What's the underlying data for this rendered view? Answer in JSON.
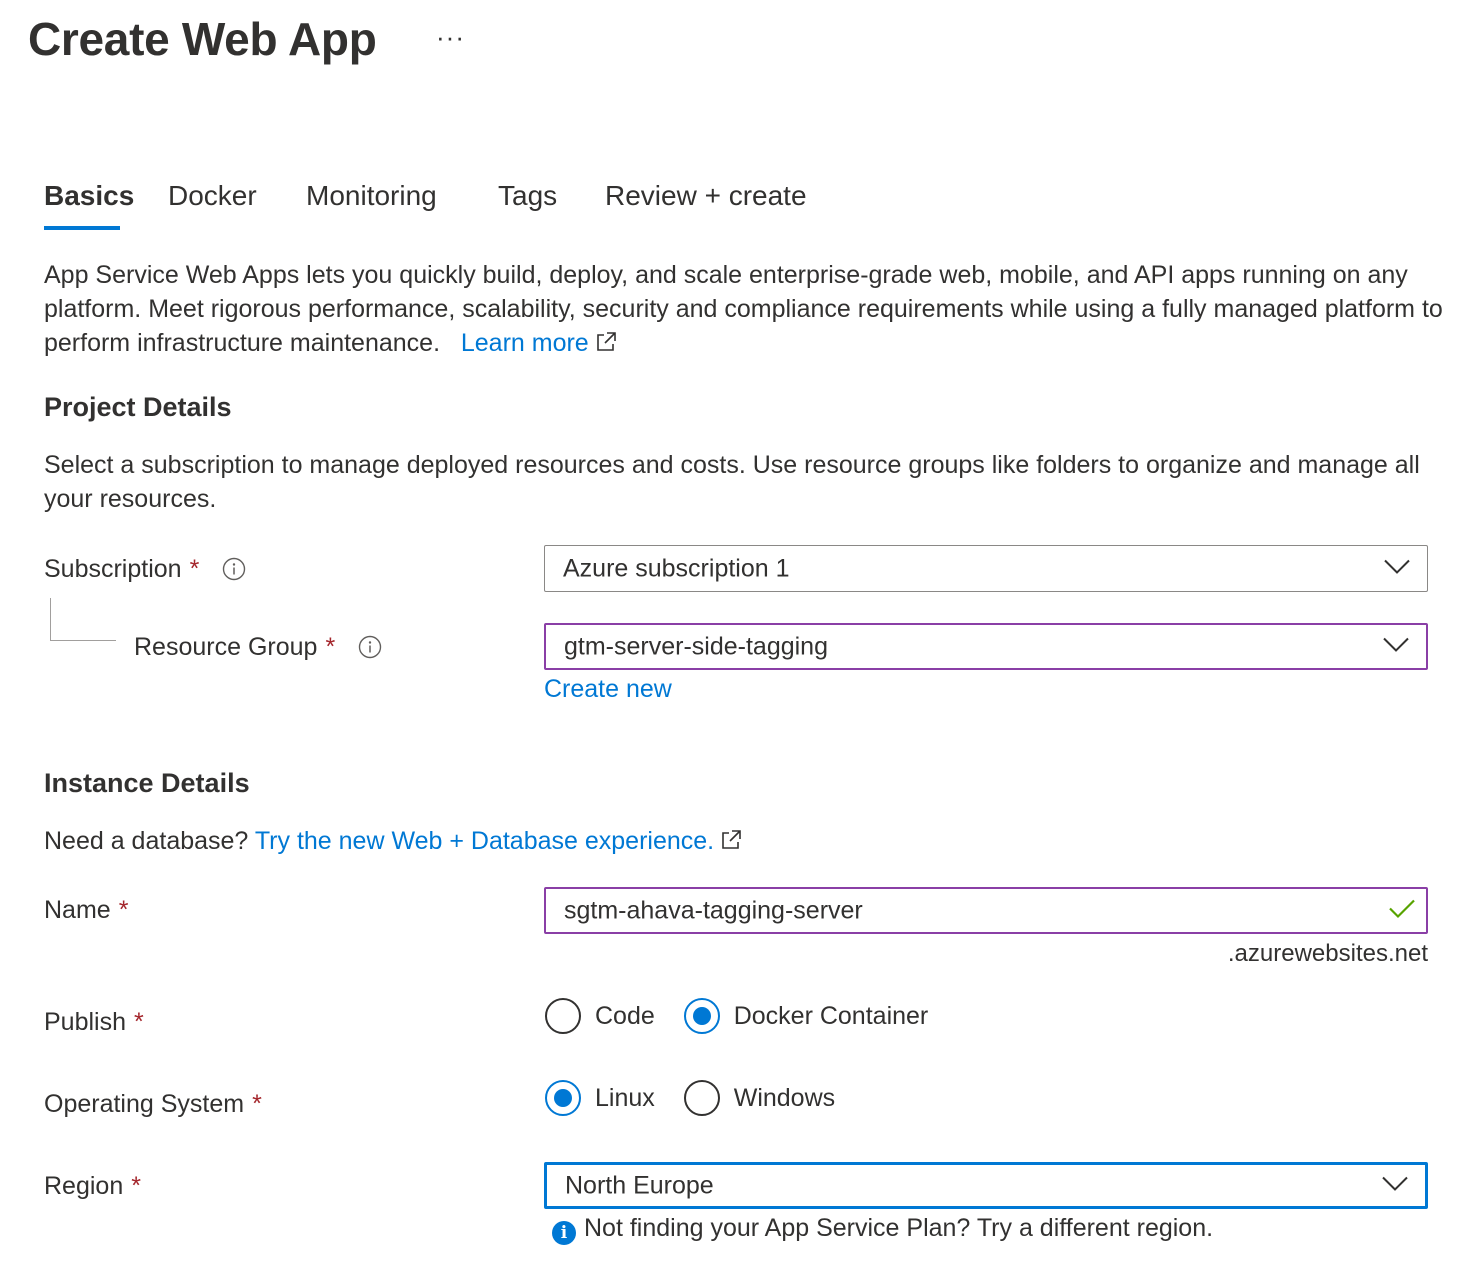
{
  "header": {
    "title": "Create Web App",
    "more_label": "···"
  },
  "tabs": [
    {
      "label": "Basics",
      "active": true
    },
    {
      "label": "Docker",
      "active": false
    },
    {
      "label": "Monitoring",
      "active": false
    },
    {
      "label": "Tags",
      "active": false
    },
    {
      "label": "Review + create",
      "active": false
    }
  ],
  "intro": {
    "text": "App Service Web Apps lets you quickly build, deploy, and scale enterprise-grade web, mobile, and API apps running on any platform. Meet rigorous performance, scalability, security and compliance requirements while using a fully managed platform to perform infrastructure maintenance.",
    "learn_more": "Learn more"
  },
  "project": {
    "heading": "Project Details",
    "description": "Select a subscription to manage deployed resources and costs. Use resource groups like folders to organize and manage all your resources.",
    "subscription_label": "Subscription",
    "subscription_value": "Azure subscription 1",
    "resource_group_label": "Resource Group",
    "resource_group_value": "gtm-server-side-tagging",
    "create_new": "Create new"
  },
  "instance": {
    "heading": "Instance Details",
    "db_prompt": "Need a database?",
    "db_link": "Try the new Web + Database experience.",
    "name_label": "Name",
    "name_value": "sgtm-ahava-tagging-server",
    "name_suffix": ".azurewebsites.net",
    "publish_label": "Publish",
    "publish_options": [
      {
        "label": "Code",
        "checked": false
      },
      {
        "label": "Docker Container",
        "checked": true
      }
    ],
    "os_label": "Operating System",
    "os_options": [
      {
        "label": "Linux",
        "checked": true
      },
      {
        "label": "Windows",
        "checked": false
      }
    ],
    "region_label": "Region",
    "region_value": "North Europe",
    "region_hint": "Not finding your App Service Plan? Try a different region."
  },
  "required_marker": "*",
  "colors": {
    "accent": "#0078d4",
    "required": "#a4262c",
    "valid_border": "#8a3fa6",
    "check": "#57a300"
  }
}
